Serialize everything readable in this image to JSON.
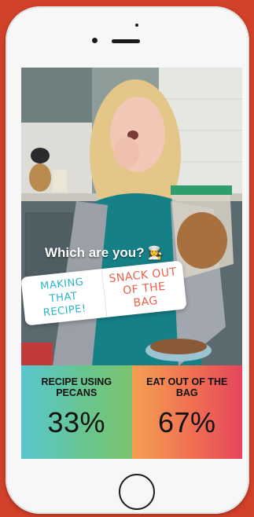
{
  "story": {
    "question": "Which are you?",
    "question_emoji": "👩‍🍳"
  },
  "poll": {
    "options": [
      {
        "label": "MAKING THAT RECIPE!"
      },
      {
        "label": "SNACK OUT OF THE BAG"
      }
    ]
  },
  "results": [
    {
      "label": "RECIPE USING PECANS",
      "percent": "33%",
      "value": 0.33,
      "color_start": "#58c6d0",
      "color_end": "#7cc46e"
    },
    {
      "label": "EAT OUT OF THE BAG",
      "percent": "67%",
      "value": 0.67,
      "color_start": "#f4a052",
      "color_end": "#e5455d"
    }
  ],
  "colors": {
    "background": "#d2412a",
    "phone": "#f7f7f7"
  },
  "icons": {
    "camera": "camera-icon",
    "speaker": "speaker-icon",
    "home": "home-button-icon"
  }
}
